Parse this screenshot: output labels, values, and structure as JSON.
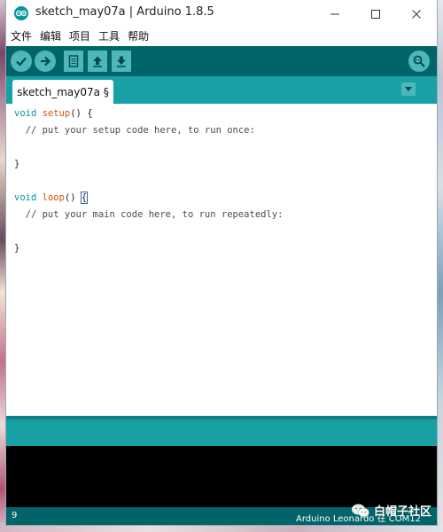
{
  "window": {
    "title": "sketch_may07a | Arduino 1.8.5",
    "min_icon": "minimize-icon",
    "max_icon": "maximize-icon",
    "close_icon": "close-icon"
  },
  "menu": {
    "items": [
      "文件",
      "编辑",
      "项目",
      "工具",
      "帮助"
    ]
  },
  "toolbar": {
    "buttons": [
      "verify-icon",
      "upload-icon",
      "new-icon",
      "open-icon",
      "save-icon"
    ],
    "serial_monitor_icon": "serial-monitor-icon"
  },
  "tabs": {
    "active_tab": "sketch_may07a §",
    "menu_icon": "tab-menu-icon"
  },
  "editor": {
    "lines": [
      {
        "kw": "void",
        "fn": "setup",
        "rest": "() {"
      },
      {
        "comment": "  // put your setup code here, to run once:"
      },
      {
        "plain": ""
      },
      {
        "plain": "}"
      },
      {
        "plain": ""
      },
      {
        "kw": "void",
        "fn": "loop",
        "rest": "() ",
        "bracket": "{"
      },
      {
        "comment": "  // put your main code here, to run repeatedly:"
      },
      {
        "plain": ""
      },
      {
        "plain": "}"
      }
    ]
  },
  "status": {
    "line_number": "9",
    "board_info": "Arduino Leonardo 在 COM12"
  },
  "watermark": {
    "text": "白帽子社区"
  },
  "colors": {
    "teal_dark": "#006468",
    "teal_mid": "#17a1a5",
    "teal_light": "#4db7bb",
    "keyword": "#00979c",
    "function": "#d35400",
    "console": "#000000"
  }
}
